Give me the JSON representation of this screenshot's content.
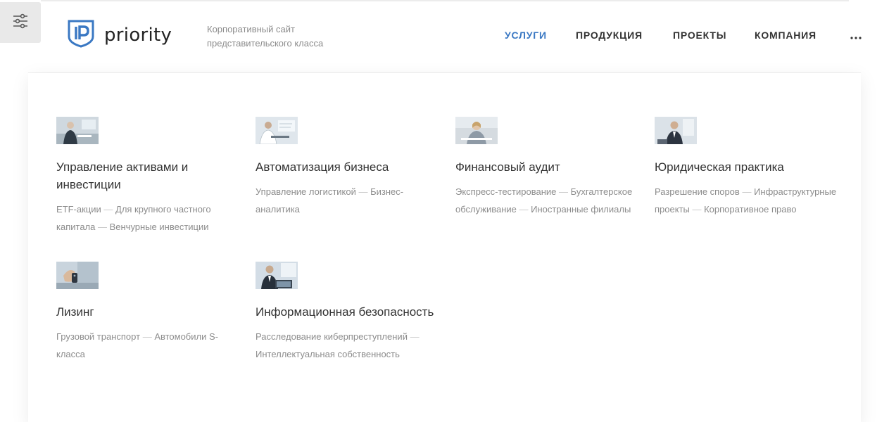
{
  "header": {
    "logo_text": "priority",
    "tagline": "Корпоративный сайт представительского класса"
  },
  "nav": {
    "items": [
      {
        "label": "УСЛУГИ",
        "active": true
      },
      {
        "label": "ПРОДУКЦИЯ",
        "active": false
      },
      {
        "label": "ПРОЕКТЫ",
        "active": false
      },
      {
        "label": "КОМПАНИЯ",
        "active": false
      }
    ],
    "more_icon": "ellipsis-icon"
  },
  "colors": {
    "accent": "#3a78c3",
    "text": "#333333",
    "muted": "#8c8c8c"
  },
  "services": [
    {
      "title": "Управление активами и инвестиции",
      "links": [
        "ETF-акции",
        "Для крупного частного капитала",
        "Венчурные инвестиции"
      ]
    },
    {
      "title": "Автоматизация бизнеса",
      "links": [
        "Управление логистикой",
        "Бизнес-аналитика"
      ]
    },
    {
      "title": "Финансовый аудит",
      "links": [
        "Экспресс-тестирование",
        "Бухгалтерское обслуживание",
        "Иностранные филиалы"
      ]
    },
    {
      "title": "Юридическая практика",
      "links": [
        "Разрешение споров",
        "Инфраструктурные проекты",
        "Корпоративное право"
      ]
    },
    {
      "title": "Лизинг",
      "links": [
        "Грузовой транспорт",
        "Автомобили S-класса"
      ]
    },
    {
      "title": "Информационная безопасность",
      "links": [
        "Расследование киберпреступлений",
        "Интеллектуальная собственность"
      ]
    }
  ]
}
